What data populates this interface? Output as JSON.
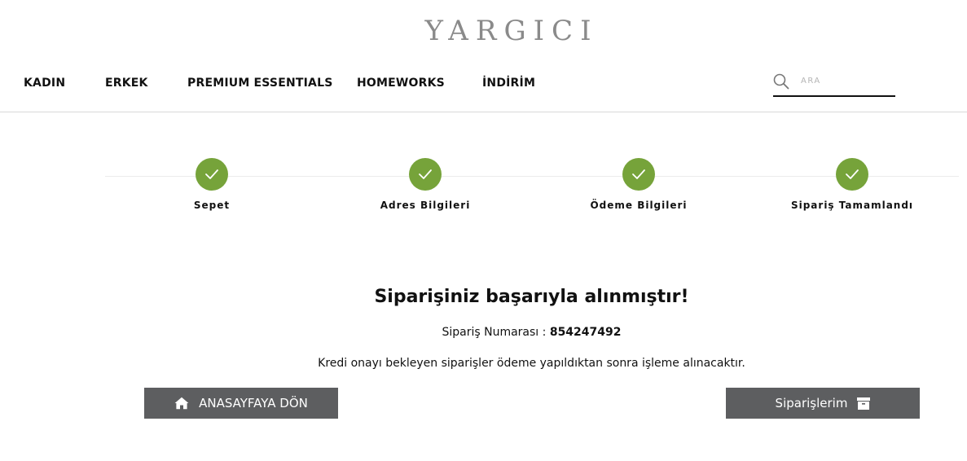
{
  "brand": {
    "logo_text": "YARGICI"
  },
  "nav": {
    "items": [
      {
        "label": "KADIN"
      },
      {
        "label": "ERKEK"
      },
      {
        "label": "PREMIUM ESSENTIALS"
      },
      {
        "label": "HOMEWORKS"
      },
      {
        "label": "İNDİRİM"
      }
    ]
  },
  "search": {
    "placeholder": "ARA",
    "icon": "search-icon"
  },
  "checkout_steps": {
    "accent_color": "#76a33a",
    "items": [
      {
        "label": "Sepet",
        "status": "completed",
        "icon": "check-icon"
      },
      {
        "label": "Adres Bilgileri",
        "status": "completed",
        "icon": "check-icon"
      },
      {
        "label": "Ödeme Bilgileri",
        "status": "completed",
        "icon": "check-icon"
      },
      {
        "label": "Sipariş Tamamlandı",
        "status": "completed",
        "icon": "check-icon"
      }
    ]
  },
  "confirmation": {
    "title": "Siparişiniz başarıyla alınmıştır!",
    "order_label": "Sipariş Numarası : ",
    "order_number": "854247492",
    "info": "Kredi onayı bekleyen siparişler ödeme yapıldıktan sonra işleme alınacaktır."
  },
  "actions": {
    "button_color": "#5d5e60",
    "home_label": "ANASAYFAYA DÖN",
    "home_icon": "home-icon",
    "orders_label": "Siparişlerim",
    "orders_icon": "archive-icon"
  }
}
